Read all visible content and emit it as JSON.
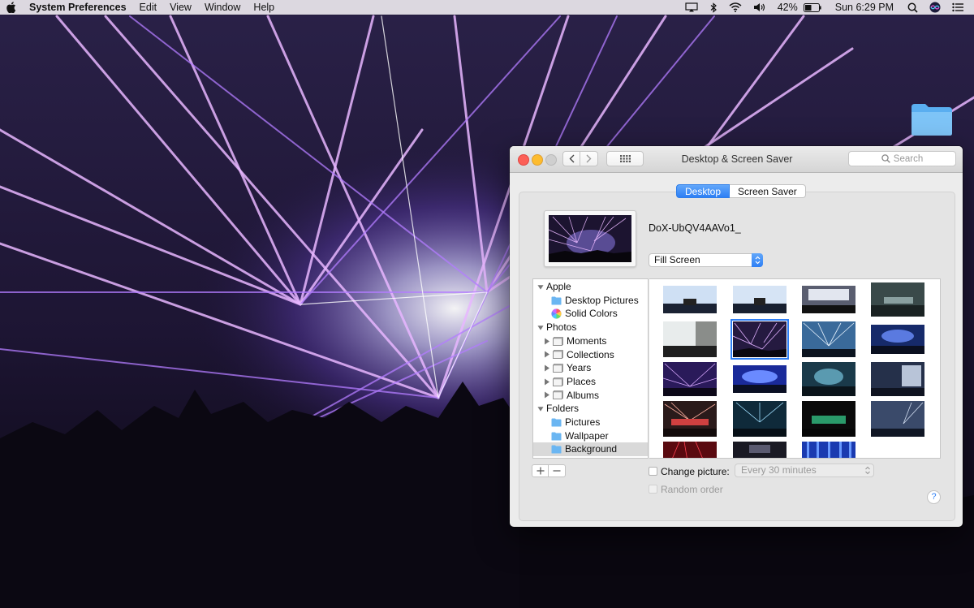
{
  "menubar": {
    "app_name": "System Preferences",
    "menus": [
      "Edit",
      "View",
      "Window",
      "Help"
    ],
    "battery_percent": "42%",
    "datetime": "Sun 6:29 PM"
  },
  "window": {
    "title": "Desktop & Screen Saver",
    "search_placeholder": "Search",
    "tabs": [
      {
        "label": "Desktop",
        "selected": true
      },
      {
        "label": "Screen Saver",
        "selected": false
      }
    ],
    "current_picture_name": "DoX-UbQV4AAVo1_",
    "fill_mode": "Fill Screen",
    "sources": [
      {
        "label": "Apple",
        "kind": "group",
        "expanded": true
      },
      {
        "label": "Desktop Pictures",
        "kind": "folder",
        "icon": "blue-folder-icon"
      },
      {
        "label": "Solid Colors",
        "kind": "item",
        "icon": "color-wheel-icon"
      },
      {
        "label": "Photos",
        "kind": "group",
        "expanded": true
      },
      {
        "label": "Moments",
        "kind": "photos",
        "icon": "photo-stack-icon"
      },
      {
        "label": "Collections",
        "kind": "photos",
        "icon": "photo-stack-icon"
      },
      {
        "label": "Years",
        "kind": "photos",
        "icon": "photo-stack-icon"
      },
      {
        "label": "Places",
        "kind": "photos",
        "icon": "photo-stack-icon"
      },
      {
        "label": "Albums",
        "kind": "photos",
        "icon": "photo-stack-icon"
      },
      {
        "label": "Folders",
        "kind": "group",
        "expanded": true
      },
      {
        "label": "Pictures",
        "kind": "folder",
        "icon": "blue-folder-icon"
      },
      {
        "label": "Wallpaper",
        "kind": "folder",
        "icon": "blue-folder-icon"
      },
      {
        "label": "Background",
        "kind": "folder",
        "icon": "blue-folder-icon",
        "selected": true
      }
    ],
    "thumbnail_count_visible": 19,
    "selected_thumbnail_index": 5,
    "change_picture_label": "Change picture:",
    "change_picture_checked": false,
    "interval": "Every 30 minutes",
    "random_order_label": "Random order",
    "help_label": "?",
    "accent_color": "#2e7ff5"
  }
}
